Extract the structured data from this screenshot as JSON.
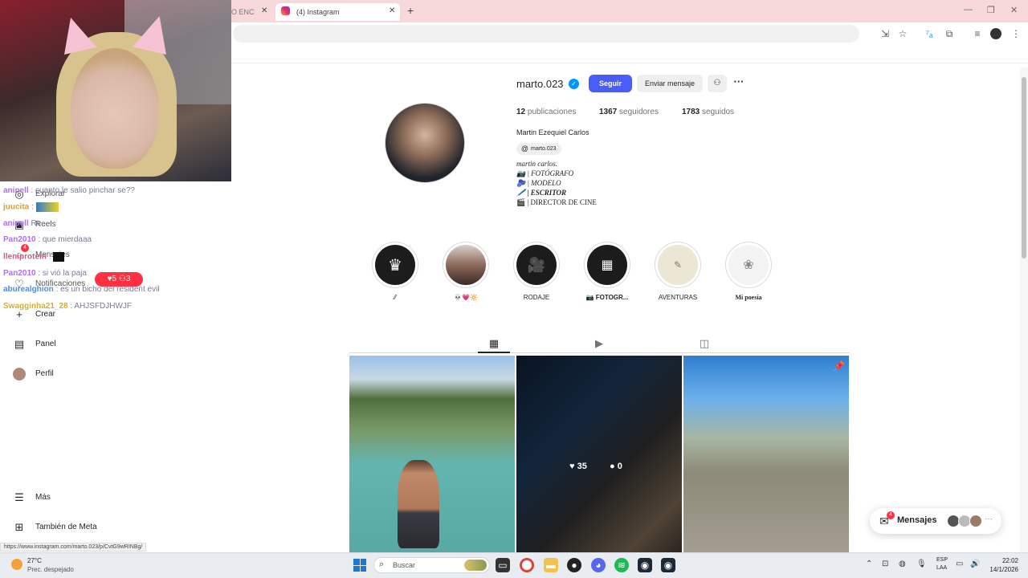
{
  "browser": {
    "tabs": [
      {
        "label": "O ENC"
      },
      {
        "label": "(4) Instagram"
      }
    ],
    "new_tab_symbol": "+",
    "status_url": "https://www.instagram.com/marto.023/p/CvtG9wRINBg/"
  },
  "chat": [
    {
      "user": "anipell",
      "text": ": cuanto le salio pinchar se??"
    },
    {
      "user": "juucita",
      "text": ":"
    },
    {
      "user": "anipell",
      "text": "Re..."
    },
    {
      "user": "Pan2010",
      "text": ": que mierdaaa"
    },
    {
      "user": "lleniprotein",
      "text": ":"
    },
    {
      "user": "Pan2010",
      "text": ": si vió la paja"
    },
    {
      "user": "aburealghion",
      "text": ": es un bicho del resident evil"
    },
    {
      "user": "Swagginha21_28",
      "text": ": AHJSFDJHWJF"
    }
  ],
  "sidebar": {
    "items": [
      {
        "label": "Explorar",
        "icon": "compass-icon"
      },
      {
        "label": "Reels",
        "icon": "reels-icon"
      },
      {
        "label": "Mensajes",
        "icon": "messenger-icon"
      },
      {
        "label": "Notificaciones",
        "icon": "heart-icon"
      },
      {
        "label": "Crear",
        "icon": "plus-icon"
      },
      {
        "label": "Panel",
        "icon": "chart-icon"
      },
      {
        "label": "Perfil",
        "icon": "avatar-icon"
      }
    ],
    "bottom": [
      {
        "label": "Más",
        "icon": "menu-icon"
      },
      {
        "label": "También de Meta",
        "icon": "grid-icon"
      }
    ],
    "notif_pill": "♥5 ⚇3",
    "messages_badge": "4"
  },
  "profile": {
    "username": "marto.023",
    "follow_label": "Seguir",
    "message_label": "Enviar mensaje",
    "stats": [
      {
        "value": "12",
        "label": "publicaciones"
      },
      {
        "value": "1367",
        "label": "seguidores"
      },
      {
        "value": "1783",
        "label": "seguidos"
      }
    ],
    "full_name": "Martin Ezequiel Carlos",
    "threads_handle": "marto.023",
    "bio": [
      "martin carlos.",
      "📷 | FOTÓGRAFO",
      "🫐 | MODELO",
      "🖊️ | ESCRITOR",
      "🎬 | DIRECTOR DE CINE"
    ]
  },
  "highlights": [
    {
      "label": "⁄⁄",
      "bg": "#1c1c1c",
      "icon": "crown-icon"
    },
    {
      "label": "💀💗🔆",
      "bg": "#8d7d74",
      "icon": "photo-icon"
    },
    {
      "label": "RODAJE",
      "bg": "#1c1c1c",
      "icon": "camera-icon"
    },
    {
      "label": "📷 FOTOGR...",
      "bg": "#1c1c1c",
      "icon": "gallery-icon"
    },
    {
      "label": "AVENTURAS",
      "bg": "#e8e1cf",
      "icon": "map-icon"
    },
    {
      "label": "Mi poesía",
      "bg": "#f1f1f1",
      "icon": "rose-icon"
    }
  ],
  "posts": [
    {
      "likes": "",
      "comments": ""
    },
    {
      "likes": "35",
      "comments": "0"
    },
    {
      "likes": "",
      "comments": ""
    }
  ],
  "messages_dock": {
    "label": "Mensajes",
    "badge": "4"
  },
  "taskbar": {
    "weather_temp": "27°C",
    "weather_desc": "Prec. despejado",
    "search_label": "Buscar",
    "lang_top": "ESP",
    "lang_bottom": "LAA",
    "time": "22:02",
    "date": "14/1/2026"
  },
  "colors": {
    "accent": "#4a5df9",
    "verified": "#0095f6",
    "badge": "#ff3040",
    "tabbar": "#f7d9dc"
  }
}
